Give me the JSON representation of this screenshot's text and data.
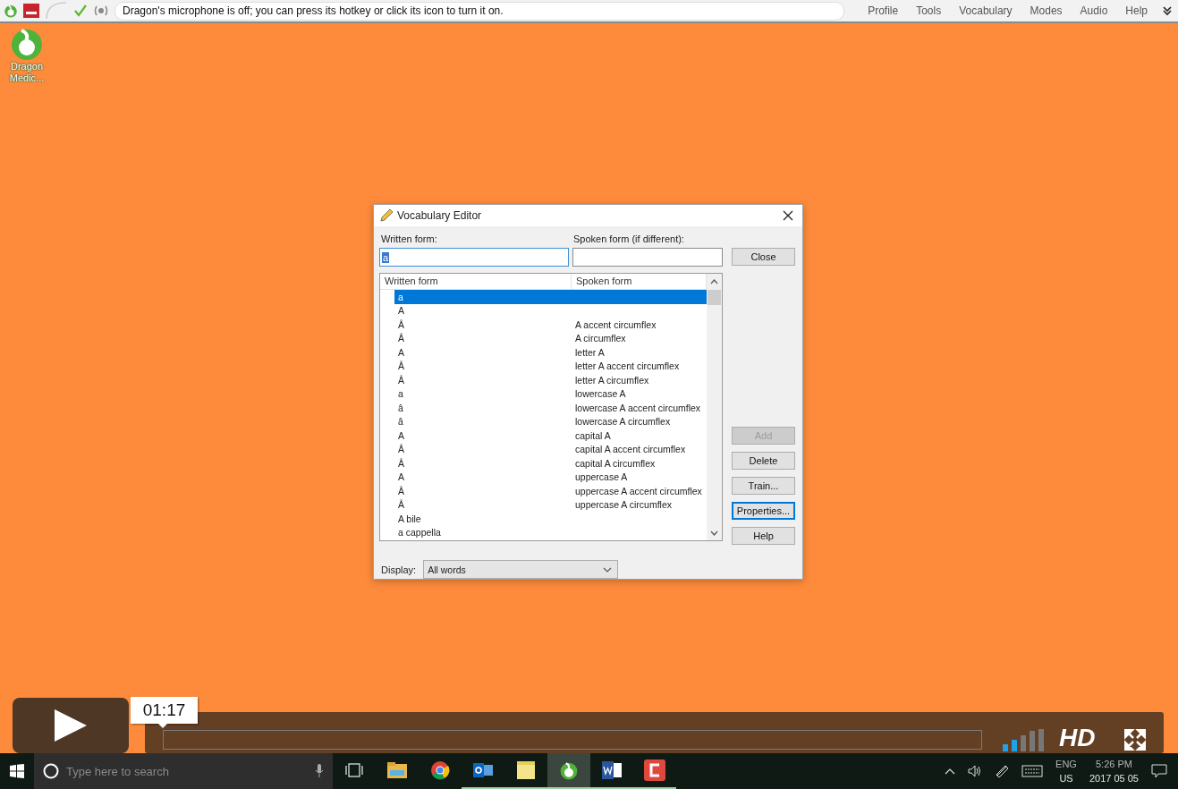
{
  "dragon_bar": {
    "message": "Dragon's microphone is off; you can press its hotkey or click its icon to turn it on.",
    "menu": [
      {
        "label": "Profile"
      },
      {
        "label": "Tools"
      },
      {
        "label": "Vocabulary"
      },
      {
        "label": "Modes"
      },
      {
        "label": "Audio"
      },
      {
        "label": "Help"
      }
    ]
  },
  "desktop_icons": [
    {
      "label": "Dragon Medic..."
    }
  ],
  "dialog": {
    "title": "Vocabulary Editor",
    "written_label": "Written form:",
    "written_value": "a",
    "spoken_label": "Spoken form (if different):",
    "columns": [
      "Written form",
      "Spoken form"
    ],
    "rows": [
      {
        "written": "a",
        "selected": true
      },
      {
        "written": "A",
        "selected": false
      },
      {
        "written": "Â",
        "spoken": "A accent circumflex",
        "selected": false
      },
      {
        "written": "Â",
        "spoken": "A circumflex",
        "selected": false
      },
      {
        "written": "A",
        "spoken": "letter A",
        "selected": false
      },
      {
        "written": "Â",
        "spoken": "letter A accent circumflex",
        "selected": false
      },
      {
        "written": "Â",
        "spoken": "letter A circumflex",
        "selected": false
      },
      {
        "written": "a",
        "spoken": "lowercase A",
        "selected": false
      },
      {
        "written": "â",
        "spoken": "lowercase A accent circumflex",
        "selected": false
      },
      {
        "written": "â",
        "spoken": "lowercase A circumflex",
        "selected": false
      },
      {
        "written": "A",
        "spoken": "capital A",
        "selected": false
      },
      {
        "written": "Â",
        "spoken": "capital A accent circumflex",
        "selected": false
      },
      {
        "written": "Â",
        "spoken": "capital A circumflex",
        "selected": false
      },
      {
        "written": "A",
        "spoken": "uppercase A",
        "selected": false
      },
      {
        "written": "Â",
        "spoken": "uppercase A accent circumflex",
        "selected": false
      },
      {
        "written": "Â",
        "spoken": "uppercase A circumflex",
        "selected": false
      },
      {
        "written": "A bile",
        "selected": false
      },
      {
        "written": "a cappella",
        "selected": false
      }
    ],
    "buttons": [
      {
        "label": "Close",
        "disabled": false,
        "focused": false
      },
      {
        "label": "Add",
        "disabled": true,
        "focused": false
      },
      {
        "label": "Delete",
        "disabled": false,
        "focused": false
      },
      {
        "label": "Train...",
        "disabled": false,
        "focused": false
      },
      {
        "label": "Properties...",
        "disabled": false,
        "focused": true
      },
      {
        "label": "Help",
        "disabled": false,
        "focused": false
      }
    ],
    "display_label": "Display:",
    "display_value": "All words"
  },
  "video_player": {
    "time": "01:17",
    "quality": "HD"
  },
  "taskbar": {
    "search_placeholder": "Type here to search",
    "apps": [
      {
        "kind": "explorer",
        "active": false,
        "running": false
      },
      {
        "kind": "chrome",
        "active": false,
        "running": false
      },
      {
        "kind": "outlook",
        "active": false,
        "running": true
      },
      {
        "kind": "notes",
        "active": false,
        "running": true
      },
      {
        "kind": "dragon",
        "active": true,
        "running": true
      },
      {
        "kind": "word",
        "active": false,
        "running": true
      },
      {
        "kind": "camtasia",
        "active": false,
        "running": true
      }
    ],
    "language": "ENG",
    "region": "US",
    "time": "5:26 PM",
    "date": "2017 05 05"
  }
}
